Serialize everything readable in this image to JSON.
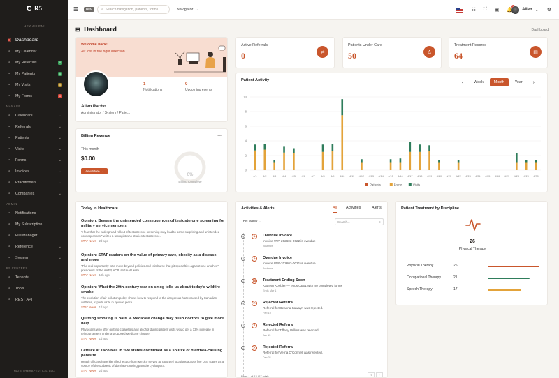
{
  "app": {
    "brand": "R5",
    "greeting": "HEY ALLEN!",
    "footer": "NATE THERAPEUTICS, LLC"
  },
  "sidebar": {
    "primary": [
      {
        "label": "Dashboard",
        "icon": "dashboard-icon",
        "active": true
      },
      {
        "label": "My Calendar",
        "icon": "calendar-icon"
      },
      {
        "label": "My Referrals",
        "icon": "referrals-icon",
        "badge": "0",
        "badge_color": "#3aa25c"
      },
      {
        "label": "My Patients",
        "icon": "patients-icon",
        "badge": "0",
        "badge_color": "#3aa25c"
      },
      {
        "label": "My Visits",
        "icon": "visits-icon",
        "badge": "0",
        "badge_color": "#b08a2a"
      },
      {
        "label": "My Forms",
        "icon": "forms-icon",
        "badge": "0",
        "badge_color": "#d9493d"
      }
    ],
    "manage_title": "MANAGE",
    "manage": [
      {
        "label": "Calendars",
        "icon": "calendar-icon"
      },
      {
        "label": "Referrals",
        "icon": "referrals-icon"
      },
      {
        "label": "Patients",
        "icon": "patients-icon"
      },
      {
        "label": "Visits",
        "icon": "visits-icon"
      },
      {
        "label": "Forms",
        "icon": "forms-icon"
      },
      {
        "label": "Invoices",
        "icon": "invoice-icon"
      },
      {
        "label": "Practitioners",
        "icon": "practitioner-icon"
      },
      {
        "label": "Companies",
        "icon": "company-icon"
      }
    ],
    "admin_title": "ADMIN",
    "admin": [
      {
        "label": "Notifications",
        "icon": "bell-icon"
      },
      {
        "label": "My Subscription",
        "icon": "subscription-icon"
      },
      {
        "label": "File Manager",
        "icon": "folder-icon"
      },
      {
        "label": "Reference",
        "icon": "reference-icon",
        "chev": true
      },
      {
        "label": "System",
        "icon": "system-icon",
        "chev": true
      }
    ],
    "tenants_title": "R5 CENTERS",
    "tenants": [
      {
        "label": "Tenants",
        "icon": "tenants-icon",
        "chev": true
      },
      {
        "label": "Tools",
        "icon": "tools-icon",
        "chev": true
      },
      {
        "label": "REST API",
        "icon": "api-icon"
      }
    ]
  },
  "topbar": {
    "env": "DEV",
    "search_placeholder": "Search navigation, patients, forms...",
    "navigator": "Navigator",
    "bell_count": "1",
    "user": "Allen"
  },
  "page": {
    "title": "Dashboard",
    "breadcrumb": "Dashboard"
  },
  "welcome": {
    "line1": "Welcome back!",
    "line2": "Get lost in the right direction.",
    "notifications_value": "1",
    "notifications_label": "Notifications",
    "events_value": "0",
    "events_label": "Upcoming events",
    "name": "Allen Racho",
    "role": "Administrator / System / Patie..."
  },
  "billing": {
    "title": "Billing Revenue",
    "menu": "...",
    "period": "This month",
    "amount": "$0.00",
    "button": "View More",
    "gauge_value": "0%",
    "gauge_label": "Billing Complete"
  },
  "kpis": [
    {
      "label": "Active Referrals",
      "value": "0",
      "icon": "referral-icon"
    },
    {
      "label": "Patients Under Care",
      "value": "50",
      "icon": "patient-icon"
    },
    {
      "label": "Treatment Records",
      "value": "64",
      "icon": "records-icon"
    }
  ],
  "activity": {
    "title": "Patient Activity",
    "ranges": [
      "Week",
      "Month",
      "Year"
    ],
    "active_range": "Month",
    "prev": "‹",
    "next": "›"
  },
  "chart_data": {
    "type": "bar",
    "title": "Patient Activity",
    "stacked": true,
    "categories": [
      "4/1",
      "4/2",
      "4/3",
      "4/4",
      "4/5",
      "4/6",
      "4/7",
      "4/8",
      "4/9",
      "4/10",
      "4/11",
      "4/12",
      "4/13",
      "4/14",
      "4/15",
      "4/16",
      "4/17",
      "4/18",
      "4/19",
      "4/20",
      "4/21",
      "4/22",
      "4/23",
      "4/24",
      "4/25",
      "4/26",
      "4/27",
      "4/28",
      "4/29",
      "4/30"
    ],
    "ylim": [
      0,
      10
    ],
    "yticks": [
      0,
      2,
      4,
      6,
      8,
      10
    ],
    "legend": "bottom",
    "series": [
      {
        "name": "Patients",
        "color": "#c9562c",
        "values": [
          0,
          0,
          0,
          0,
          0,
          0,
          0,
          0,
          0,
          0,
          0,
          0,
          0,
          0,
          0,
          0,
          0,
          0,
          0,
          0,
          0,
          0,
          0,
          0,
          0,
          0,
          0,
          0,
          0,
          0
        ]
      },
      {
        "name": "Forms",
        "color": "#e3a33a",
        "values": [
          2.7,
          2.8,
          1.0,
          2.4,
          2.3,
          0,
          0,
          2.5,
          2.6,
          7.5,
          0,
          1.0,
          0,
          0,
          1.0,
          1.0,
          2.5,
          2.5,
          2.6,
          1.0,
          0,
          1.0,
          0,
          0,
          0,
          0,
          0,
          1.0,
          1.0,
          1.0
        ]
      },
      {
        "name": "Visits",
        "color": "#2f7d5b",
        "values": [
          0.8,
          0.8,
          0.4,
          0.8,
          0.7,
          0,
          0,
          1.0,
          1.0,
          2.2,
          0,
          0.5,
          0,
          0,
          0.5,
          0.6,
          1.4,
          1.0,
          0.8,
          0.4,
          0,
          0.4,
          0,
          0,
          0,
          0,
          0,
          1.3,
          0.4,
          0.4
        ]
      }
    ]
  },
  "health": {
    "title": "Today in Healthcare",
    "items": [
      {
        "title": "Opinion: Beware the unintended consequences of testosterone screening for military servicemembers",
        "desc": "\"I fear that the widespread rollout of testosterone screening may lead to some surprising and unintended consequences,\" writes a urologist who studies testosterone.",
        "source": "STAT News",
        "age": "2d ago"
      },
      {
        "title": "Opinion: STAT readers on the value of primary care, obesity as a disease, and more",
        "desc": "\"The real opportunity is to move beyond policies and reimburse that pit specialties against one another,\" presidents of the AAFP, ACP, and AAP write.",
        "source": "STAT News",
        "age": "19h ago"
      },
      {
        "title": "Opinion: What the 20th-century war on smog tells us about today's wildfire smoke",
        "desc": "The evolution of air pollution policy shows how to respond to the dangerous haze caused by Canadian wildfires, experts write in opinion piece.",
        "source": "STAT News",
        "age": "1d ago"
      },
      {
        "title": "Quitting smoking is hard. A Medicare change may push doctors to give more help",
        "desc": "Physicians who offer quitting cigarettes and alcohol during patient visits would get a 13% increase in reimbursement under a proposed Medicare change.",
        "source": "STAT News",
        "age": "1d ago"
      },
      {
        "title": "Lettuce at Taco Bell in five states confirmed as a source of diarrhea-causing parasite",
        "desc": "Health officials have identified lettuce from Mexico served at Taco Bell locations across five U.S. states as a source of the outbreak of diarrhea-causing parasite cyclospora.",
        "source": "STAT News",
        "age": "2d ago"
      }
    ]
  },
  "alerts": {
    "title": "Activities & Alerts",
    "tabs": [
      "All",
      "Activities",
      "Alerts"
    ],
    "filter": "This Week",
    "search_placeholder": "Search...",
    "items": [
      {
        "title": "Overdue Invoice",
        "body": "Invoice #NV-202603-0022 is overdue",
        "meta": "Just now",
        "icon": "$"
      },
      {
        "title": "Overdue Invoice",
        "body": "Invoice #NV-202603-0021 is overdue",
        "meta": "Just now",
        "icon": "$"
      },
      {
        "title": "Treatment Ending Soon",
        "body": "Kathryn Koebler — ends 03/01 with no completed forms",
        "meta": "Ends Mar 1",
        "icon": "▦"
      },
      {
        "title": "Rejected Referral",
        "body": "Referral for Deanna Sawayn was rejected.",
        "meta": "Feb 10",
        "icon": "✕"
      },
      {
        "title": "Rejected Referral",
        "body": "Referral for Tiffany Willms was rejected.",
        "meta": "Jan 15",
        "icon": "✕"
      },
      {
        "title": "Rejected Referral",
        "body": "Referral for Verna O'Connell was rejected.",
        "meta": "Dec 31",
        "icon": "✕"
      }
    ],
    "pager": "Page 1 of 12 (67 total)"
  },
  "discipline": {
    "title": "Patient Treatment by Discipline",
    "total": "26",
    "total_label": "Physical Therapy",
    "rows": [
      {
        "name": "Physical Therapy",
        "value": "26",
        "color": "#c9562c",
        "fraction": 1.0
      },
      {
        "name": "Occupational Therapy",
        "value": "21",
        "color": "#2f7d5b",
        "fraction": 0.81
      },
      {
        "name": "Speech Therapy",
        "value": "17",
        "color": "#e3a33a",
        "fraction": 0.65
      }
    ]
  }
}
